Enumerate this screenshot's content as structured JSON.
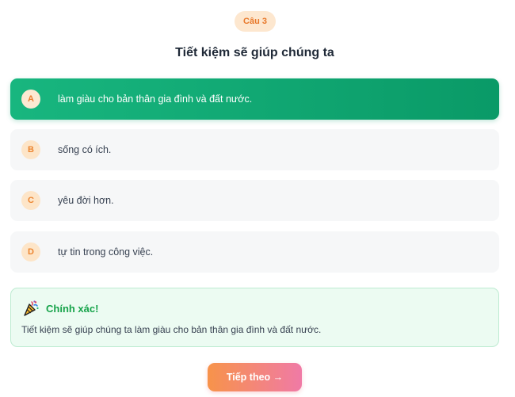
{
  "header": {
    "badge": "Câu 3"
  },
  "question": "Tiết kiệm sẽ giúp chúng ta",
  "options": [
    {
      "letter": "A",
      "text": "làm giàu cho bản thân gia đình và đất nước.",
      "state": "correct"
    },
    {
      "letter": "B",
      "text": "sống có ích.",
      "state": "default"
    },
    {
      "letter": "C",
      "text": "yêu đời hơn.",
      "state": "default"
    },
    {
      "letter": "D",
      "text": "tự tin trong công việc.",
      "state": "default"
    }
  ],
  "feedback": {
    "icon": "party-popper-icon",
    "title": "Chính xác!",
    "explanation": "Tiết kiệm sẽ giúp chúng ta làm giàu cho bản thân gia đình và đất nước."
  },
  "actions": {
    "next_label": "Tiếp theo →"
  },
  "colors": {
    "accent_orange": "#e8782a",
    "correct_green": "#12a872",
    "feedback_bg": "#ecfbf2",
    "feedback_title": "#16a34a"
  }
}
